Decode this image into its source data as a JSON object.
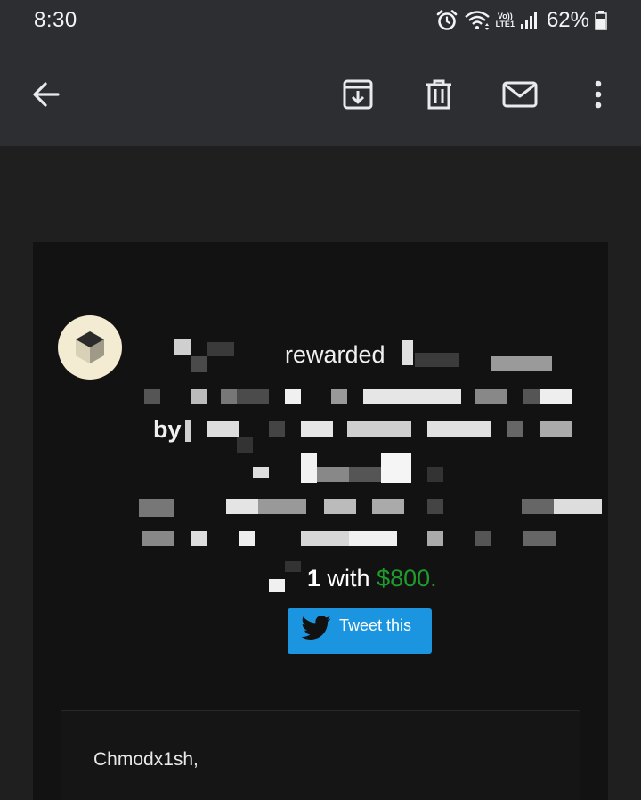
{
  "status_bar": {
    "time": "8:30",
    "network_label_top": "Vo))",
    "network_label_bottom": "LTE1",
    "battery_percent": "62%"
  },
  "app_bar": {
    "icons": [
      "back-arrow-icon",
      "archive-icon",
      "trash-icon",
      "mail-icon",
      "more-vertical-icon"
    ]
  },
  "email": {
    "reward_word": "rewarded",
    "by_prefix": "by",
    "bounty_number": "1",
    "with_word": "with",
    "bounty_amount": "$800.",
    "tweet_label": "Tweet this",
    "greeting": "Chmodx1sh,"
  },
  "colors": {
    "amount_green": "#1f9a2c",
    "tweet_blue": "#1b95e0"
  }
}
